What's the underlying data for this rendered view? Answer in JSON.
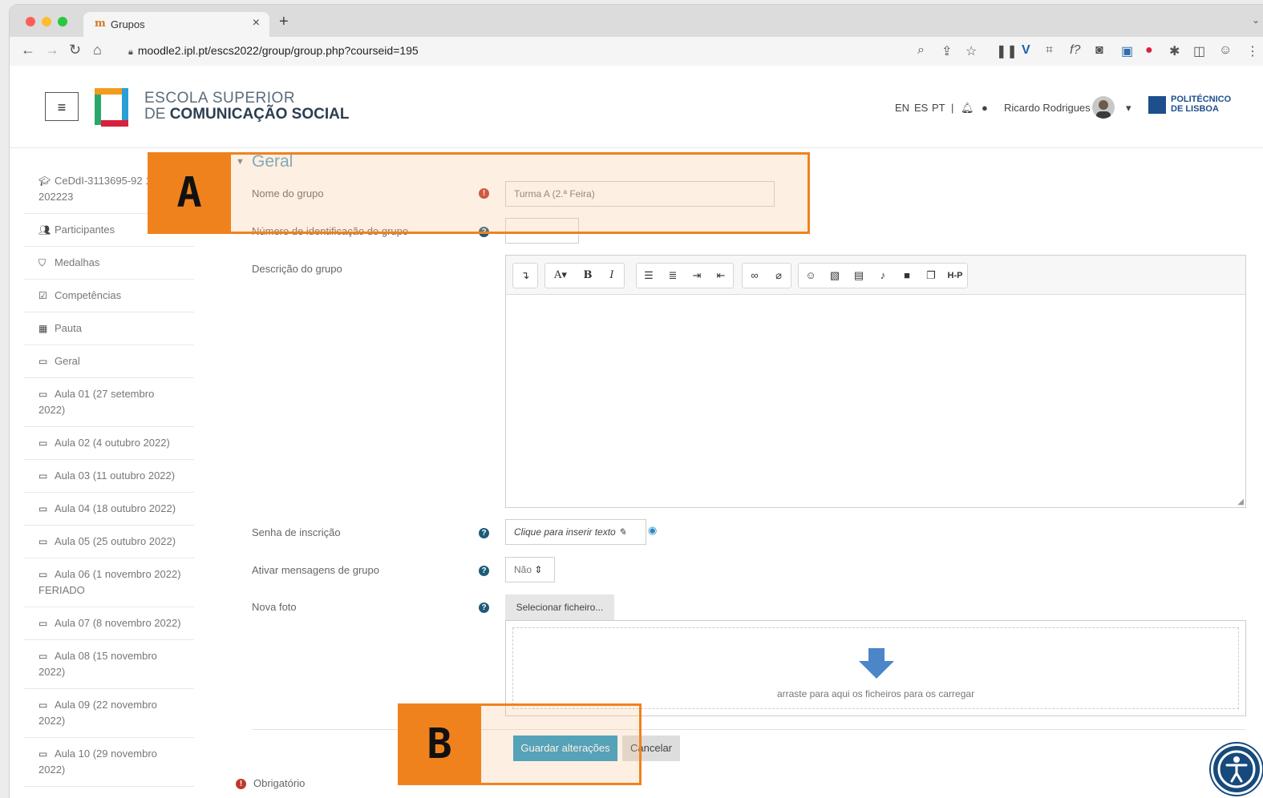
{
  "browser": {
    "tab_title": "Grupos",
    "url": "moodle2.ipl.pt/escs2022/group/group.php?courseid=195"
  },
  "header": {
    "brand_line1": "ESCOLA SUPERIOR",
    "brand_line2_prefix": "DE",
    "brand_line2_bold": "COMUNICAÇÃO SOCIAL",
    "lang_en": "EN",
    "lang_es": "ES",
    "lang_pt": "PT",
    "user_name": "Ricardo Rodrigues",
    "ipl_line1": "POLITÉCNICO",
    "ipl_line2": "DE LISBOA"
  },
  "sidebar": {
    "items": [
      {
        "label": "CeDdI-3113695-92 1-202223",
        "icon": "graduation-cap-icon"
      },
      {
        "label": "Participantes",
        "icon": "users-icon"
      },
      {
        "label": "Medalhas",
        "icon": "shield-icon"
      },
      {
        "label": "Competências",
        "icon": "check-square-icon"
      },
      {
        "label": "Pauta",
        "icon": "table-icon"
      },
      {
        "label": "Geral",
        "icon": "folder-icon"
      },
      {
        "label": "Aula 01 (27 setembro 2022)",
        "icon": "folder-icon"
      },
      {
        "label": "Aula 02 (4 outubro 2022)",
        "icon": "folder-icon"
      },
      {
        "label": "Aula 03 (11 outubro 2022)",
        "icon": "folder-icon"
      },
      {
        "label": "Aula 04 (18 outubro 2022)",
        "icon": "folder-icon"
      },
      {
        "label": "Aula 05 (25 outubro 2022)",
        "icon": "folder-icon"
      },
      {
        "label": "Aula 06 (1 novembro 2022) FERIADO",
        "icon": "folder-icon"
      },
      {
        "label": "Aula 07 (8 novembro 2022)",
        "icon": "folder-icon"
      },
      {
        "label": "Aula 08 (15 novembro 2022)",
        "icon": "folder-icon"
      },
      {
        "label": "Aula 09 (22 novembro 2022)",
        "icon": "folder-icon"
      },
      {
        "label": "Aula 10 (29 novembro 2022)",
        "icon": "folder-icon"
      }
    ]
  },
  "form": {
    "section_title": "Geral",
    "group_name_label": "Nome do grupo",
    "group_name_value": "Turma A (2.ª Feira)",
    "group_id_label": "Número de identificação do grupo",
    "description_label": "Descrição do grupo",
    "enrol_key_label": "Senha de inscrição",
    "enrol_key_placeholder": "Clique para inserir texto",
    "messaging_label": "Ativar mensagens de grupo",
    "messaging_value": "Não",
    "photo_label": "Nova foto",
    "select_file_label": "Selecionar ficheiro...",
    "drop_text": "arraste para aqui os ficheiros para os carregar",
    "save_label": "Guardar alterações",
    "cancel_label": "Cancelar",
    "required_note": "Obrigatório"
  },
  "annotations": {
    "a_label": "A",
    "b_label": "B",
    "accent_color": "#f0821e"
  }
}
